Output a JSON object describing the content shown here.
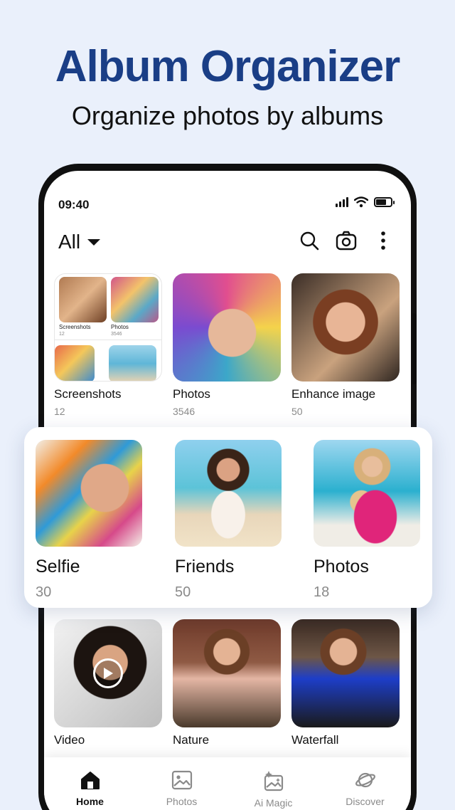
{
  "promo": {
    "headline": "Album Organizer",
    "subhead": "Organize photos by albums"
  },
  "status": {
    "time": "09:40"
  },
  "toolbar": {
    "filter_label": "All",
    "icons": [
      "search-icon",
      "camera-icon",
      "more-vertical-icon"
    ]
  },
  "albums_top": [
    {
      "name": "Screenshots",
      "count": "12",
      "mini": [
        {
          "label": "Screenshots",
          "count": "12"
        },
        {
          "label": "Photos",
          "count": "3546"
        }
      ]
    },
    {
      "name": "Photos",
      "count": "3546"
    },
    {
      "name": "Enhance image",
      "count": "50"
    }
  ],
  "featured": [
    {
      "name": "Selfie",
      "count": "30"
    },
    {
      "name": "Friends",
      "count": "50"
    },
    {
      "name": "Photos",
      "count": "18"
    }
  ],
  "albums_bottom": [
    {
      "name": "Video"
    },
    {
      "name": "Nature"
    },
    {
      "name": "Waterfall"
    }
  ],
  "nav": [
    {
      "label": "Home",
      "icon": "home-icon",
      "active": true
    },
    {
      "label": "Photos",
      "icon": "image-icon",
      "active": false
    },
    {
      "label": "Ai Magic",
      "icon": "sparkle-image-icon",
      "active": false
    },
    {
      "label": "Discover",
      "icon": "planet-icon",
      "active": false
    }
  ],
  "colors": {
    "headline": "#1a3e86",
    "background": "#eaf0fb",
    "muted": "#8a8a8a"
  }
}
